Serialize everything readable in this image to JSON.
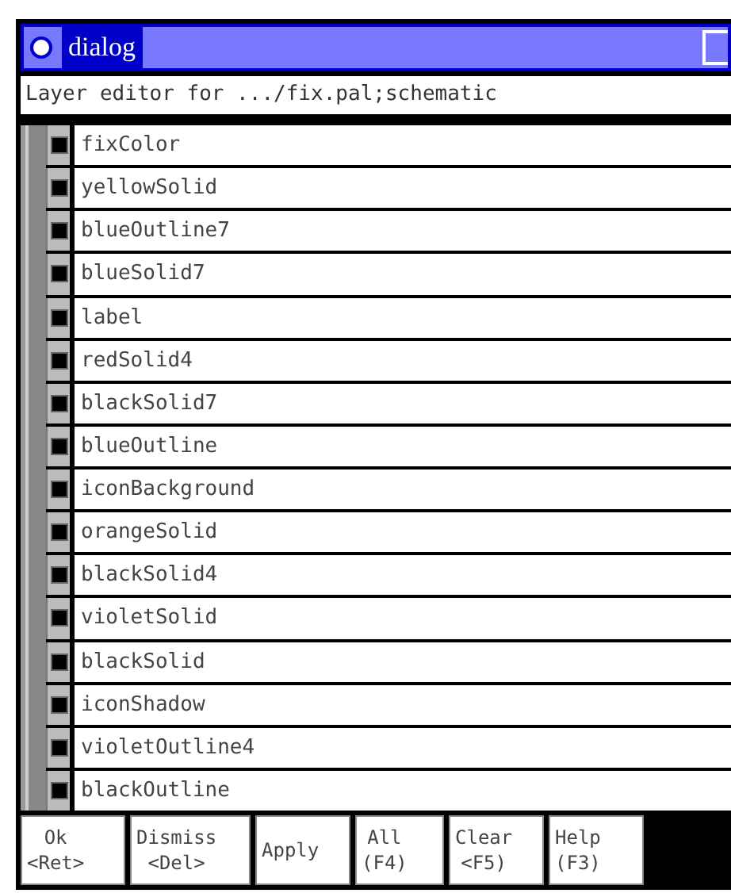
{
  "window": {
    "title": "dialog"
  },
  "header": "Layer editor for .../fix.pal;schematic",
  "layers": [
    {
      "name": "fixColor",
      "checked": true
    },
    {
      "name": "yellowSolid",
      "checked": true
    },
    {
      "name": "blueOutline7",
      "checked": true
    },
    {
      "name": "blueSolid7",
      "checked": true
    },
    {
      "name": "label",
      "checked": true
    },
    {
      "name": "redSolid4",
      "checked": true
    },
    {
      "name": "blackSolid7",
      "checked": true
    },
    {
      "name": "blueOutline",
      "checked": true
    },
    {
      "name": "iconBackground",
      "checked": true
    },
    {
      "name": "orangeSolid",
      "checked": true
    },
    {
      "name": "blackSolid4",
      "checked": true
    },
    {
      "name": "violetSolid",
      "checked": true
    },
    {
      "name": "blackSolid",
      "checked": true
    },
    {
      "name": "iconShadow",
      "checked": true
    },
    {
      "name": "violetOutline4",
      "checked": true
    },
    {
      "name": "blackOutline",
      "checked": true
    }
  ],
  "buttons": [
    {
      "label": "Ok",
      "key": "<Ret>"
    },
    {
      "label": "Dismiss",
      "key": "<Del>"
    },
    {
      "label": "Apply"
    },
    {
      "label": "All",
      "key": "(F4)"
    },
    {
      "label": "Clear",
      "key": "<F5)"
    },
    {
      "label": "Help",
      "key": "(F3)"
    }
  ]
}
